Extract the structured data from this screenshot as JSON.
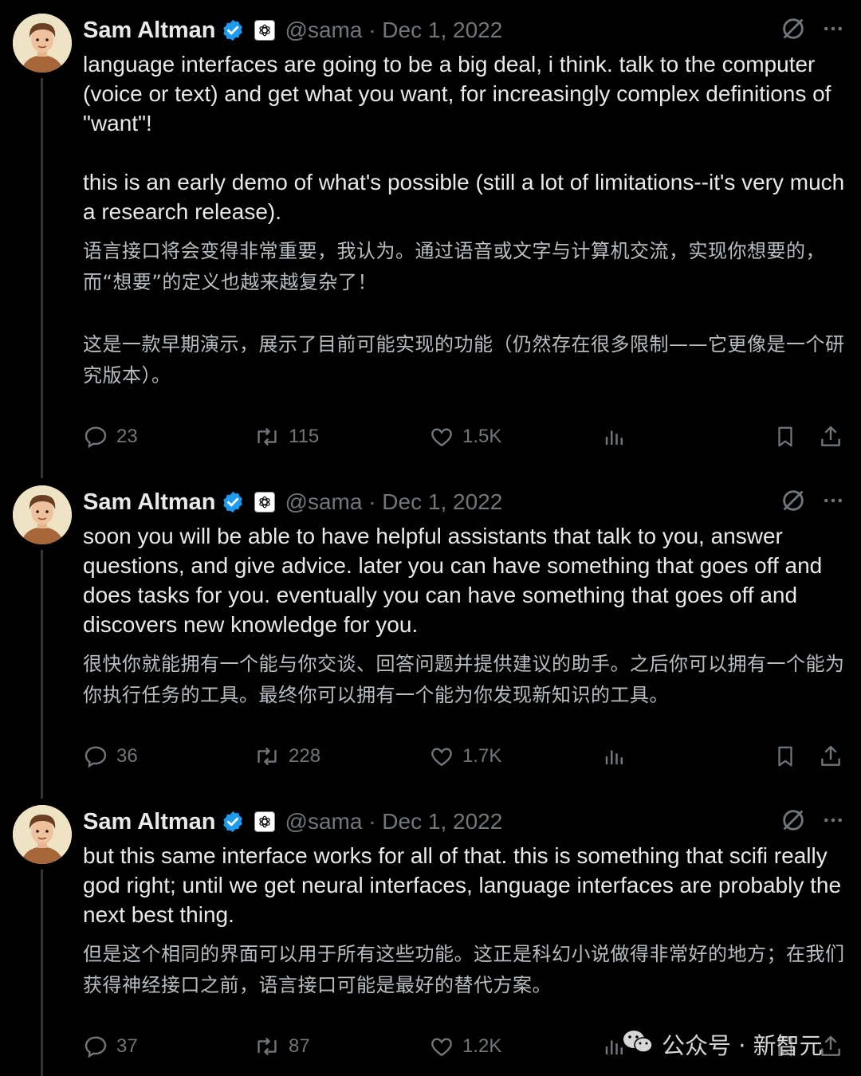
{
  "tweets": [
    {
      "name": "Sam Altman",
      "handle": "@sama · Dec 1, 2022",
      "body": [
        "language interfaces are going to be a big deal, i think. talk to the computer (voice or text) and get what you want, for increasingly complex definitions of \"want\"!",
        "this is an early demo of what's possible (still a lot of limitations--it's very much a research release)."
      ],
      "translation": [
        "语言接口将会变得非常重要，我认为。通过语音或文字与计算机交流，实现你想要的，而“想要”的定义也越来越复杂了！",
        "这是一款早期演示，展示了目前可能实现的功能（仍然存在很多限制——它更像是一个研究版本）。"
      ],
      "replies": "23",
      "reposts": "115",
      "likes": "1.5K"
    },
    {
      "name": "Sam Altman",
      "handle": "@sama · Dec 1, 2022",
      "body": [
        "soon you will be able to have helpful assistants that talk to you, answer questions, and give advice. later you can have something that goes off and does tasks for you. eventually you can have something that goes off and discovers new knowledge for you."
      ],
      "translation": [
        "很快你就能拥有一个能与你交谈、回答问题并提供建议的助手。之后你可以拥有一个能为你执行任务的工具。最终你可以拥有一个能为你发现新知识的工具。"
      ],
      "replies": "36",
      "reposts": "228",
      "likes": "1.7K"
    },
    {
      "name": "Sam Altman",
      "handle": "@sama · Dec 1, 2022",
      "body": [
        "but this same interface works for all of that. this is something that scifi really god right; until we get neural interfaces, language interfaces are probably the next best thing."
      ],
      "translation": [
        "但是这个相同的界面可以用于所有这些功能。这正是科幻小说做得非常好的地方；在我们获得神经接口之前，语言接口可能是最好的替代方案。"
      ],
      "replies": "37",
      "reposts": "87",
      "likes": "1.2K"
    }
  ],
  "watermark": "公众号 · 新智元",
  "colors": {
    "background": "#000000",
    "text": "#e7e9ea",
    "muted": "#71767b",
    "verified": "#1d9bf0"
  },
  "icons": [
    "verified-badge-icon",
    "openai-affiliate-icon",
    "grok-icon",
    "more-icon",
    "reply-icon",
    "repost-icon",
    "like-icon",
    "views-icon",
    "bookmark-icon",
    "share-icon",
    "wechat-icon"
  ]
}
